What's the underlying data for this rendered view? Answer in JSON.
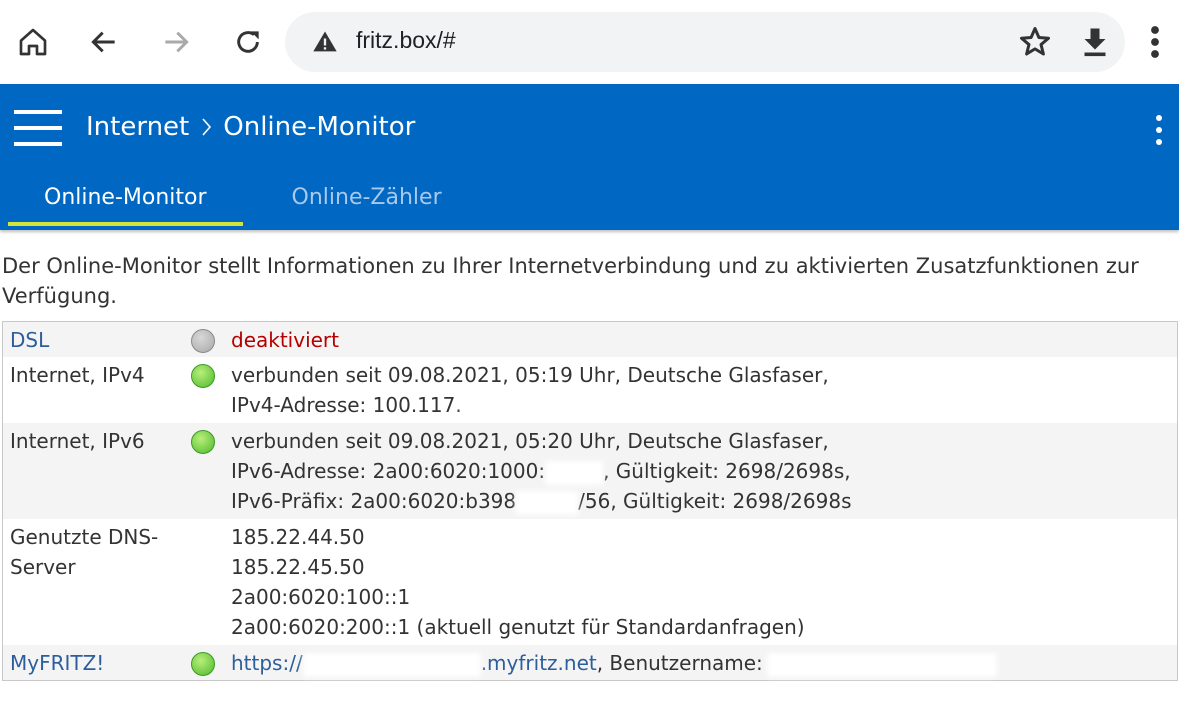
{
  "browser": {
    "url": "fritz.box/#",
    "icons": [
      "home-icon",
      "back-icon",
      "forward-icon",
      "reload-icon",
      "warning-icon",
      "star-icon",
      "download-icon",
      "more-vert-icon"
    ]
  },
  "header": {
    "breadcrumb_parent": "Internet",
    "breadcrumb_current": "Online-Monitor",
    "tabs": [
      {
        "label": "Online-Monitor",
        "active": true
      },
      {
        "label": "Online-Zähler",
        "active": false
      }
    ],
    "accent_color": "#0068c3",
    "tab_indicator_color": "#d6e33b"
  },
  "intro": "Der Online-Monitor stellt Informationen zu Ihrer Internetverbindung und zu aktivierten Zusatzfunktionen zur Verfügung.",
  "rows": {
    "dsl": {
      "label": "DSL",
      "status": "grey",
      "value": "deaktiviert"
    },
    "ipv4": {
      "label": "Internet, IPv4",
      "status": "green",
      "line1": "verbunden seit 09.08.2021, 05:19 Uhr, Deutsche Glasfaser,",
      "line2": "IPv4-Adresse: 100.117."
    },
    "ipv6": {
      "label": "Internet, IPv6",
      "status": "green",
      "line1": "verbunden seit 09.08.2021, 05:20 Uhr, Deutsche Glasfaser,",
      "line2a": "IPv6-Adresse: 2a00:6020:1000:",
      "line2b": ", Gültigkeit: 2698/2698s,",
      "line3a": "IPv6-Präfix: 2a00:6020:b398",
      "line3b": "/56, Gültigkeit: 2698/2698s"
    },
    "dns": {
      "label": "Genutzte DNS-Server",
      "servers": [
        "185.22.44.50",
        "185.22.45.50",
        "2a00:6020:100::1",
        "2a00:6020:200::1 (aktuell genutzt für Standardanfragen)"
      ]
    },
    "myfritz": {
      "label": "MyFRITZ!",
      "status": "green",
      "link_prefix": "https://",
      "link_suffix": ".myfritz.net",
      "user_label": ", Benutzername:"
    }
  }
}
